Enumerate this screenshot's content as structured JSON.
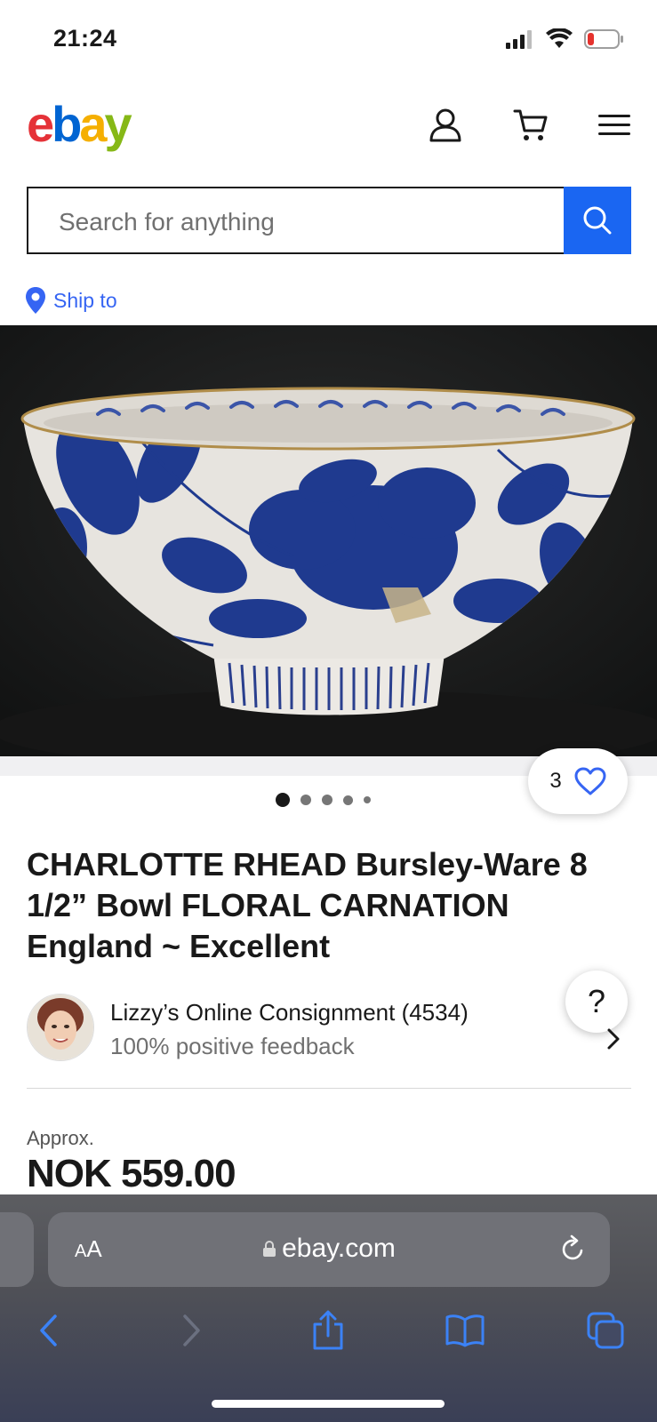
{
  "status_bar": {
    "time": "21:24"
  },
  "header": {
    "logo_letters": [
      "e",
      "b",
      "a",
      "y"
    ]
  },
  "search": {
    "placeholder": "Search for anything"
  },
  "ship_to": {
    "label": "Ship to"
  },
  "gallery": {
    "like_count": "3",
    "image_count": 5,
    "active_index": 0
  },
  "listing": {
    "title": "CHARLOTTE RHEAD Bursley-Ware 8 1/2” Bowl FLORAL CARNATION England ~ Excellent",
    "approx_label": "Approx.",
    "price": "NOK 559.00"
  },
  "seller": {
    "name": "Lizzy’s Online Consignment (4534)",
    "feedback": "100% positive feedback"
  },
  "help": {
    "label": "?"
  },
  "browser": {
    "aa_large": "A",
    "aa_small": "A",
    "url": "ebay.com"
  },
  "colors": {
    "accent": "#3665f3",
    "search_button": "#1a66f2",
    "ebay_e": "#e53238",
    "ebay_b": "#0064d2",
    "ebay_a": "#f5af02",
    "ebay_y": "#86b817",
    "bowl_blue": "#1f3a8f"
  }
}
